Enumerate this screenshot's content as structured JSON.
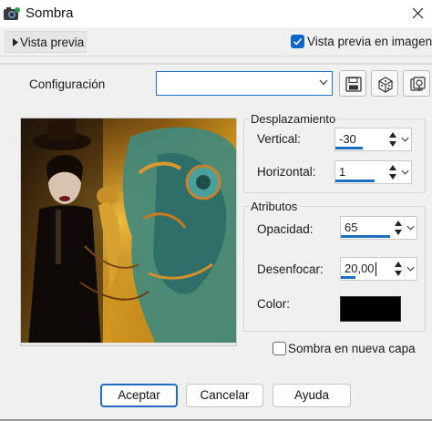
{
  "window": {
    "title": "Sombra",
    "close_icon": "close-icon"
  },
  "preview": {
    "toggle_label": "Vista previa",
    "checkbox_label": "Vista previa en imagen",
    "checkbox_checked": true
  },
  "config": {
    "label": "Configuración",
    "value": ""
  },
  "offset": {
    "group_title": "Desplazamiento",
    "vertical_label": "Vertical:",
    "vertical_value": "-30",
    "horizontal_label": "Horizontal:",
    "horizontal_value": "1"
  },
  "attributes": {
    "group_title": "Atributos",
    "opacity_label": "Opacidad:",
    "opacity_value": "65",
    "blur_label": "Desenfocar:",
    "blur_value": "20,00",
    "color_label": "Color:",
    "color_hex": "#000000"
  },
  "shadow_layer": {
    "label": "Sombra en nueva capa",
    "checked": false
  },
  "buttons": {
    "accept": "Aceptar",
    "cancel": "Cancelar",
    "help": "Ayuda"
  },
  "colors": {
    "accent": "#1c6fbf"
  }
}
